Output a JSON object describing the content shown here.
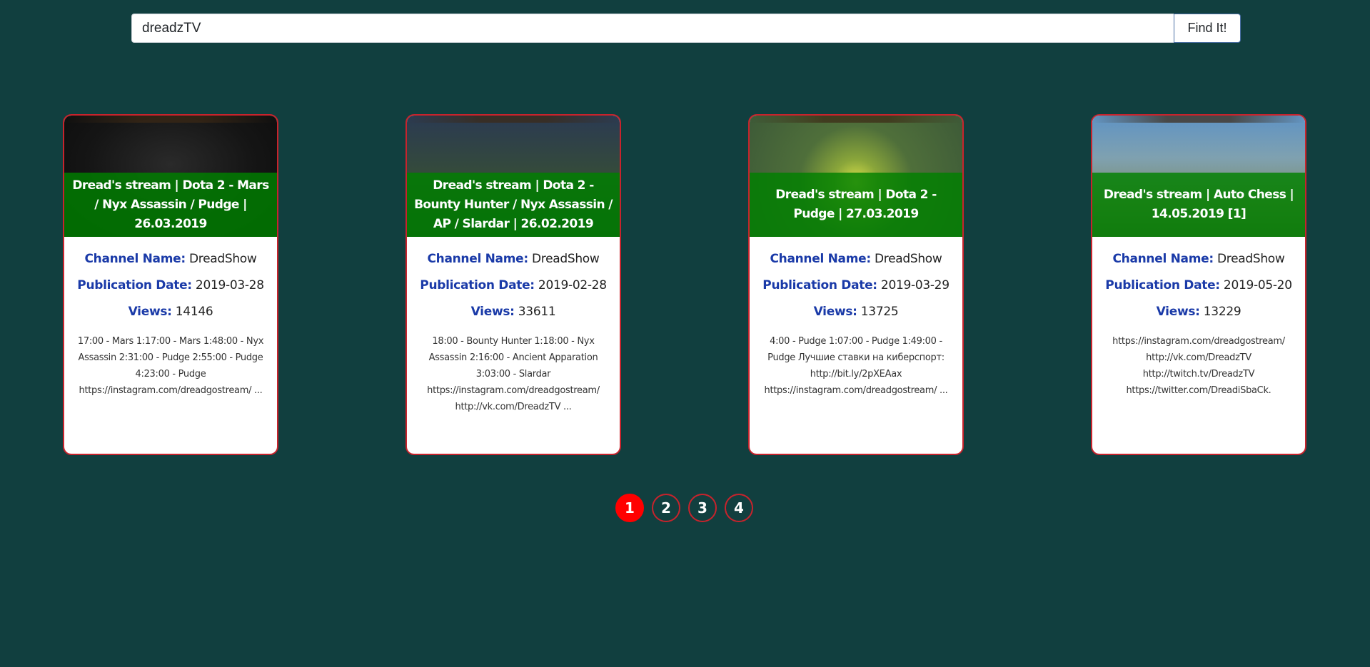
{
  "search": {
    "value": "dreadzTV",
    "button_label": "Find It!"
  },
  "labels": {
    "channel": "Channel Name:",
    "date": "Publication Date:",
    "views": "Views:"
  },
  "cards": [
    {
      "title": "Dread's stream | Dota 2 - Mars / Nyx Assassin / Pudge | 26.03.2019",
      "channel": "DreadShow",
      "date": "2019-03-28",
      "views": "14146",
      "description": "17:00 - Mars 1:17:00 - Mars 1:48:00 - Nyx Assassin 2:31:00 - Pudge 2:55:00 - Pudge 4:23:00 - Pudge https://instagram.com/dreadgostream/ ..."
    },
    {
      "title": "Dread's stream | Dota 2 - Bounty Hunter / Nyx Assassin / AP / Slardar | 26.02.2019",
      "channel": "DreadShow",
      "date": "2019-02-28",
      "views": "33611",
      "description": "18:00 - Bounty Hunter 1:18:00 - Nyx Assassin 2:16:00 - Ancient Apparation 3:03:00 - Slardar https://instagram.com/dreadgostream/ http://vk.com/DreadzTV ..."
    },
    {
      "title": "Dread's stream | Dota 2 - Pudge | 27.03.2019",
      "channel": "DreadShow",
      "date": "2019-03-29",
      "views": "13725",
      "description": "4:00 - Pudge 1:07:00 - Pudge 1:49:00 - Pudge Лучшие ставки на киберспорт: http://bit.ly/2pXEAax https://instagram.com/dreadgostream/ ..."
    },
    {
      "title": "Dread's stream | Auto Chess | 14.05.2019 [1]",
      "channel": "DreadShow",
      "date": "2019-05-20",
      "views": "13229",
      "description": "https://instagram.com/dreadgostream/ http://vk.com/DreadzTV http://twitch.tv/DreadzTV https://twitter.com/DreadiSbaCk."
    }
  ],
  "pagination": {
    "pages": [
      "1",
      "2",
      "3",
      "4"
    ],
    "current": "1"
  },
  "colors": {
    "background": "#113f3f",
    "card_border": "#c8232c",
    "title_overlay": "#008000",
    "label_blue": "#1a3aa8",
    "page_active": "#ff0000"
  }
}
